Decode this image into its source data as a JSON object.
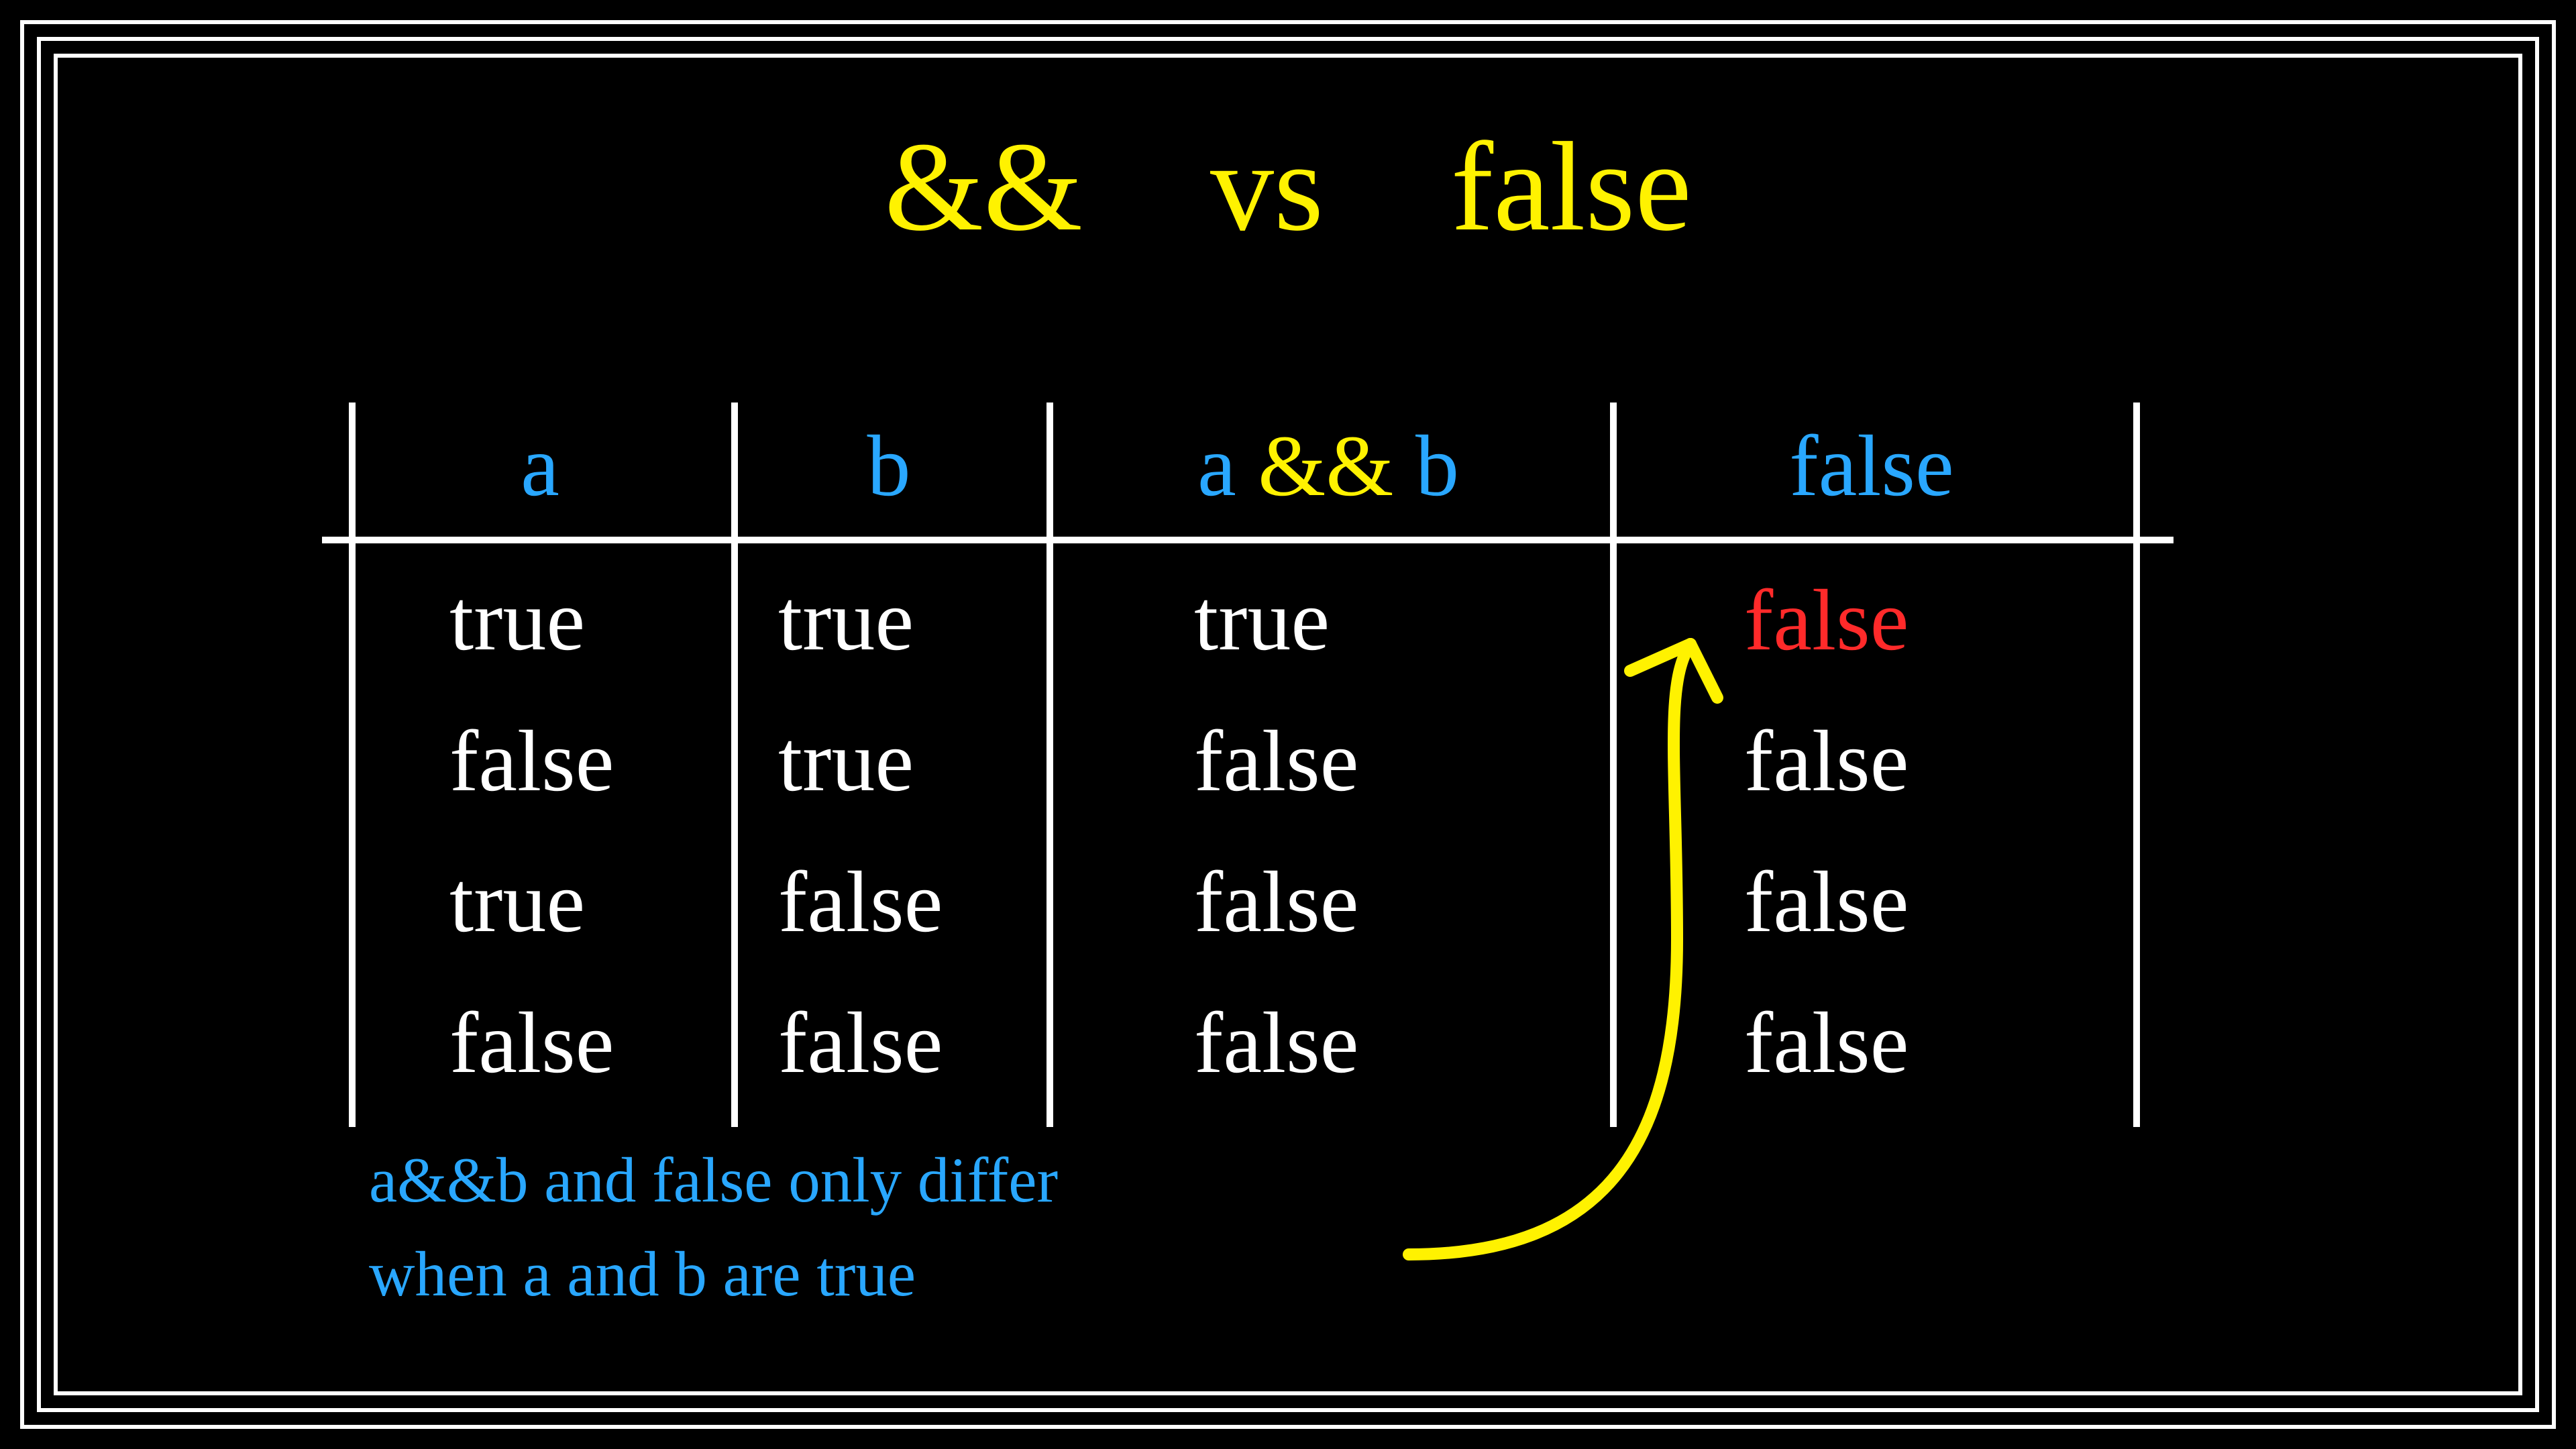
{
  "title": {
    "op": "&&",
    "vs": "vs",
    "word": "false"
  },
  "headers": {
    "a": "a",
    "b": "b",
    "and_a": "a",
    "and_op": "&&",
    "and_b": "b",
    "false": "false"
  },
  "rows": [
    {
      "a": "true",
      "b": "true",
      "ab": "true",
      "f": "false",
      "f_hl": true
    },
    {
      "a": "false",
      "b": "true",
      "ab": "false",
      "f": "false",
      "f_hl": false
    },
    {
      "a": "true",
      "b": "false",
      "ab": "false",
      "f": "false",
      "f_hl": false
    },
    {
      "a": "false",
      "b": "false",
      "ab": "false",
      "f": "false",
      "f_hl": false
    }
  ],
  "note": {
    "l1": "a&&b and false only differ",
    "l2": "when a and b are true"
  },
  "chart_data": {
    "type": "table",
    "title": "&& vs false",
    "columns": [
      "a",
      "b",
      "a && b",
      "false"
    ],
    "rows": [
      [
        "true",
        "true",
        "true",
        "false"
      ],
      [
        "false",
        "true",
        "false",
        "false"
      ],
      [
        "true",
        "false",
        "false",
        "false"
      ],
      [
        "false",
        "false",
        "false",
        "false"
      ]
    ],
    "highlight": {
      "row": 0,
      "col": 3
    },
    "annotation": "a&&b and false only differ when a and b are true"
  },
  "colors": {
    "bg": "#000000",
    "line": "#ffffff",
    "header": "#29a7ff",
    "op": "#fff200",
    "cell": "#ffffff",
    "highlight": "#ff2a2a",
    "arrow": "#fff200"
  }
}
